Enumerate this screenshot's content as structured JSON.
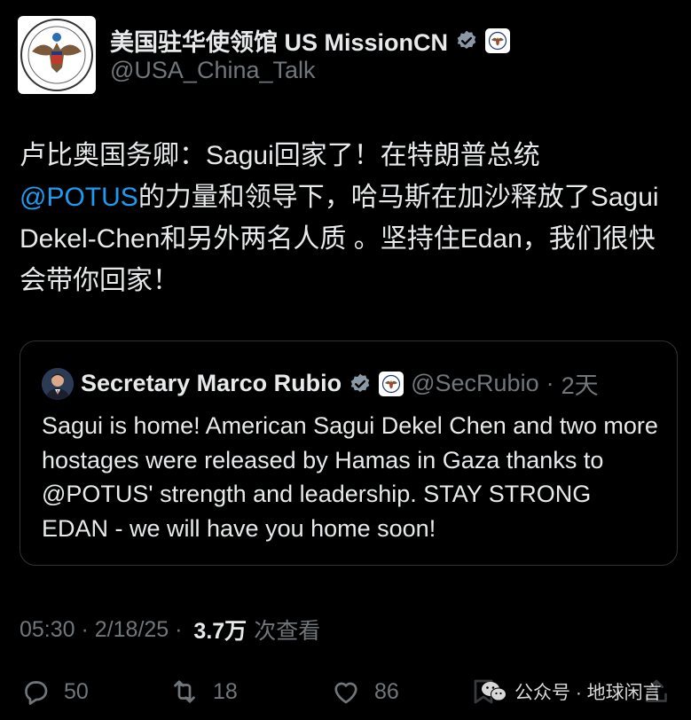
{
  "author": {
    "display_name": "美国驻华使领馆 US MissionCN",
    "handle": "@USA_China_Talk",
    "verified": true
  },
  "tweet": {
    "text_part1": "卢比奥国务卿：Sagui回家了！在特朗普总统",
    "mention": "@POTUS",
    "text_part2": "的力量和领导下，哈马斯在加沙释放了Sagui Dekel-Chen和另外两名人质 。坚持住Edan，我们很快会带你回家！"
  },
  "quoted_tweet": {
    "display_name": "Secretary Marco Rubio",
    "handle": "@SecRubio",
    "separator": "·",
    "time": "2天",
    "text": "Sagui is home! American Sagui Dekel Chen and two more hostages were released by Hamas in Gaza thanks to @POTUS' strength and leadership. STAY STRONG EDAN - we will have you home soon!"
  },
  "meta": {
    "time": "05:30",
    "sep1": " · ",
    "date": "2/18/25",
    "sep2": " · ",
    "views_count": "3.7万",
    "views_label": "次查看"
  },
  "actions": {
    "replies": "50",
    "retweets": "18",
    "likes": "86"
  },
  "watermark": {
    "text": "公众号 · 地球闲言"
  },
  "colors": {
    "background": "#000000",
    "text": "#e7e9ea",
    "muted": "#71767b",
    "accent": "#1d9bf0",
    "border": "#2f3336"
  }
}
